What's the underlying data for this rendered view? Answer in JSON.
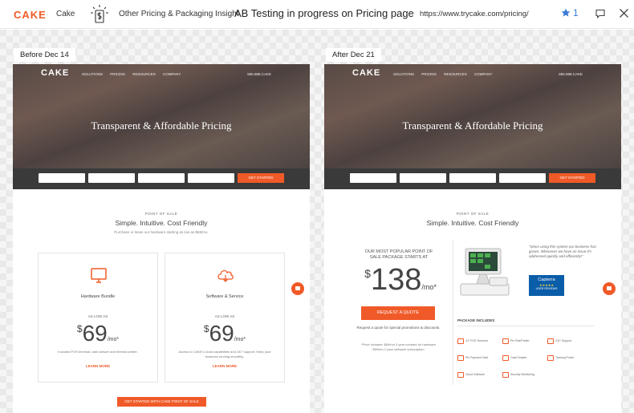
{
  "header": {
    "logo": "CAKE",
    "brand_name": "Cake",
    "category": "Other Pricing & Packaging Insight",
    "headline": "AB Testing in progress on Pricing page",
    "url": "https://www.trycake.com/pricing/",
    "star_count": "1",
    "icons": [
      "dollar-doc-icon",
      "star-icon",
      "comment-icon",
      "close-icon"
    ],
    "accent_color": "#f05a28",
    "star_color": "#3a7bd5"
  },
  "before": {
    "tag": "Before Dec 14",
    "hero_logo": "CAKE",
    "hero_nav": "SOLUTIONS PRICING RESOURCES COMPANY",
    "hero_phone": "855.888.CAKE",
    "hero_title": "Transparent & Affordable Pricing",
    "form_cta": "GET STARTED",
    "kicker": "POINT OF SALE",
    "title": "Simple. Intuitive. Cost Friendly",
    "subtitle": "Purchase or lease our hardware starting as low as $69/mo.",
    "cards": [
      {
        "title": "Hardware Bundle",
        "as_low_as": "AS LOW AS",
        "currency": "$",
        "price": "69",
        "per": "/mo*",
        "desc": "Includes POS terminal, cash drawer and thermal printer.",
        "link": "LEARN MORE"
      },
      {
        "title": "Software & Service",
        "as_low_as": "AS LOW AS",
        "currency": "$",
        "price": "69",
        "per": "/mo*",
        "desc": "Access to CAKE's cloud capabilities and 24/7 support. Keep your business running smoothly.",
        "link": "LEARN MORE"
      }
    ],
    "bottom_cta": "GET STARTED WITH CAKE POINT OF SALE"
  },
  "after": {
    "tag": "After Dec 21",
    "hero_logo": "CAKE",
    "hero_nav": "SOLUTIONS PRICING RESOURCES COMPANY",
    "hero_phone": "855.888.CAKE",
    "hero_title": "Transparent & Affordable Pricing",
    "form_cta": "GET STARTED",
    "kicker": "POINT OF SALE",
    "title": "Simple. Intuitive. Cost Friendly",
    "package_head": "OUR MOST POPULAR POINT OF SALE PACKAGE STARTS AT",
    "currency": "$",
    "price": "138",
    "per": "/mo*",
    "quote_btn": "REQUEST A QUOTE",
    "quote_note": "Request a quote for special promotions & discounts.",
    "price_includes": "*Price includes: $69/mo 3 year contract for hardware $69/mo 2 year software subscription",
    "testimonial": "\"Since using this system our business has grown. Whenever we have an issue it's addressed quickly and efficiently!\"",
    "capterra": "Capterra",
    "capterra_stars": "★★★★★",
    "capterra_reviews": "USER REVIEWS",
    "package_label": "PACKAGE INCLUDES",
    "features": [
      "14\" POS Terminal",
      "Pin Pad/Printer",
      "24/7 Support",
      "Pin Payment Gate",
      "Cash Drawer",
      "Training Portal",
      "Cloud Software",
      "Security Monitoring"
    ]
  }
}
